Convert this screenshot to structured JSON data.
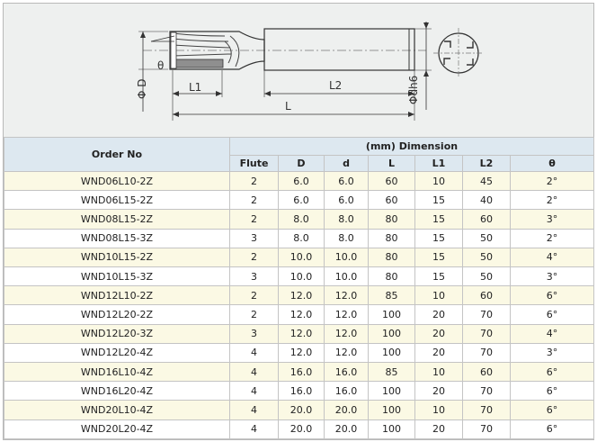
{
  "drawing": {
    "labels": {
      "phi_d": "Φ D",
      "theta": "θ",
      "l1": "L1",
      "l2": "L2",
      "l": "L",
      "phi_dh6": "Φdh6"
    }
  },
  "table": {
    "order_header": "Order No",
    "dimension_header": "(mm) Dimension",
    "columns": [
      "Flute",
      "D",
      "d",
      "L",
      "L1",
      "L2",
      "θ"
    ],
    "rows": [
      {
        "order": "WND06L10-2Z",
        "flute": "2",
        "D": "6.0",
        "d": "6.0",
        "L": "60",
        "L1": "10",
        "L2": "45",
        "theta": "2°"
      },
      {
        "order": "WND06L15-2Z",
        "flute": "2",
        "D": "6.0",
        "d": "6.0",
        "L": "60",
        "L1": "15",
        "L2": "40",
        "theta": "2°"
      },
      {
        "order": "WND08L15-2Z",
        "flute": "2",
        "D": "8.0",
        "d": "8.0",
        "L": "80",
        "L1": "15",
        "L2": "60",
        "theta": "3°"
      },
      {
        "order": "WND08L15-3Z",
        "flute": "3",
        "D": "8.0",
        "d": "8.0",
        "L": "80",
        "L1": "15",
        "L2": "50",
        "theta": "2°"
      },
      {
        "order": "WND10L15-2Z",
        "flute": "2",
        "D": "10.0",
        "d": "10.0",
        "L": "80",
        "L1": "15",
        "L2": "50",
        "theta": "4°"
      },
      {
        "order": "WND10L15-3Z",
        "flute": "3",
        "D": "10.0",
        "d": "10.0",
        "L": "80",
        "L1": "15",
        "L2": "50",
        "theta": "3°"
      },
      {
        "order": "WND12L10-2Z",
        "flute": "2",
        "D": "12.0",
        "d": "12.0",
        "L": "85",
        "L1": "10",
        "L2": "60",
        "theta": "6°"
      },
      {
        "order": "WND12L20-2Z",
        "flute": "2",
        "D": "12.0",
        "d": "12.0",
        "L": "100",
        "L1": "20",
        "L2": "70",
        "theta": "6°"
      },
      {
        "order": "WND12L20-3Z",
        "flute": "3",
        "D": "12.0",
        "d": "12.0",
        "L": "100",
        "L1": "20",
        "L2": "70",
        "theta": "4°"
      },
      {
        "order": "WND12L20-4Z",
        "flute": "4",
        "D": "12.0",
        "d": "12.0",
        "L": "100",
        "L1": "20",
        "L2": "70",
        "theta": "3°"
      },
      {
        "order": "WND16L10-4Z",
        "flute": "4",
        "D": "16.0",
        "d": "16.0",
        "L": "85",
        "L1": "10",
        "L2": "60",
        "theta": "6°"
      },
      {
        "order": "WND16L20-4Z",
        "flute": "4",
        "D": "16.0",
        "d": "16.0",
        "L": "100",
        "L1": "20",
        "L2": "70",
        "theta": "6°"
      },
      {
        "order": "WND20L10-4Z",
        "flute": "4",
        "D": "20.0",
        "d": "20.0",
        "L": "100",
        "L1": "10",
        "L2": "70",
        "theta": "6°"
      },
      {
        "order": "WND20L20-4Z",
        "flute": "4",
        "D": "20.0",
        "d": "20.0",
        "L": "100",
        "L1": "20",
        "L2": "70",
        "theta": "6°"
      }
    ]
  }
}
